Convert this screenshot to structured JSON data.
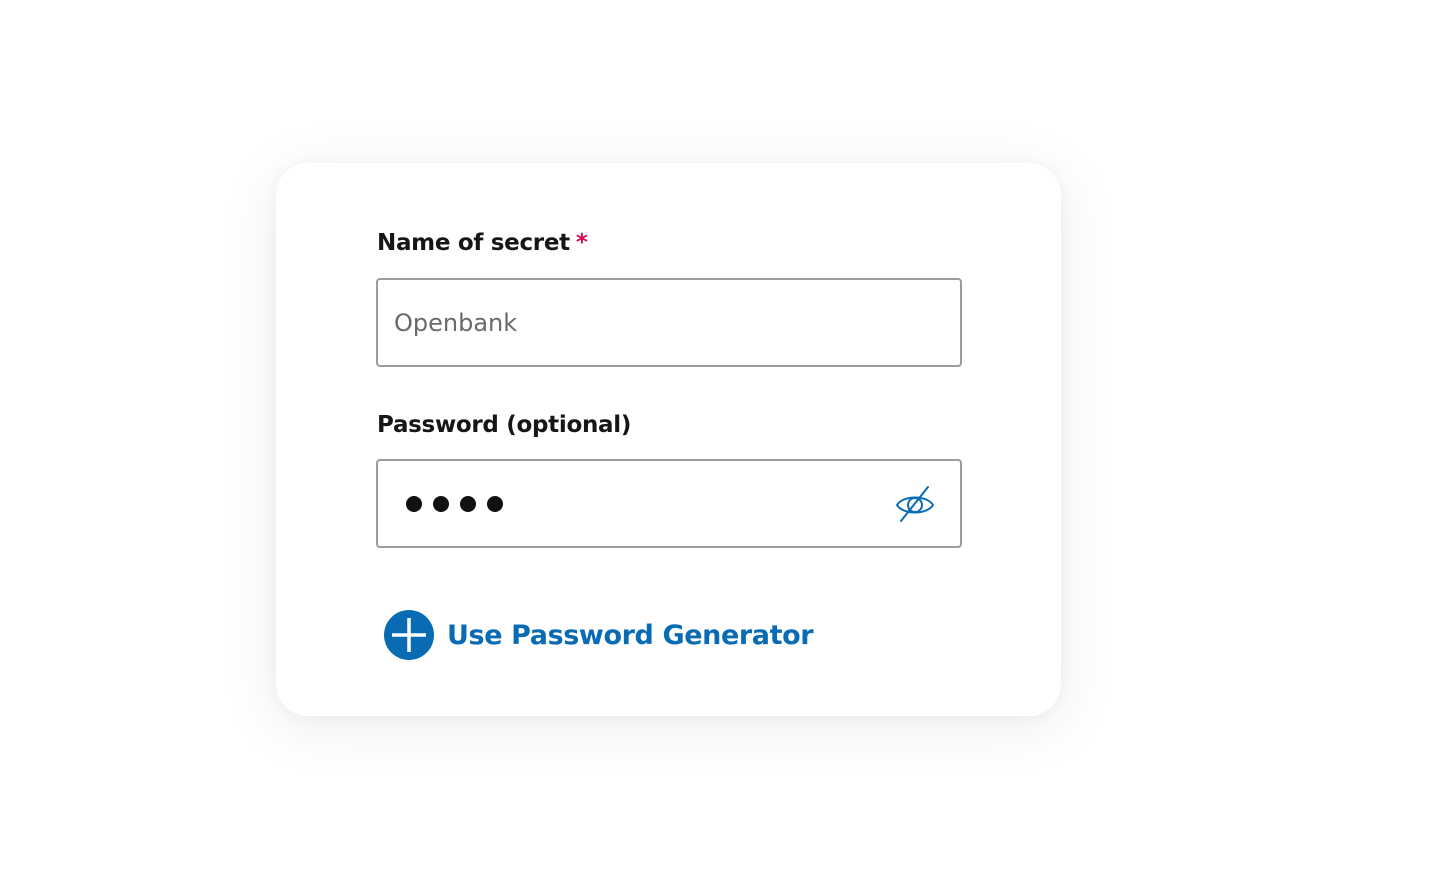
{
  "form": {
    "name_field": {
      "label": "Name of secret",
      "required_marker": "*",
      "value": "",
      "placeholder": "Openbank"
    },
    "password_field": {
      "label": "Password (optional)",
      "masked_length": 4,
      "visibility_icon": "eye-slash-icon"
    },
    "generator_link": {
      "label": "Use Password Generator",
      "icon": "plus-circle-icon"
    }
  },
  "colors": {
    "accent": "#0a6bb5",
    "required": "#d20a5a",
    "text": "#161616",
    "border": "#9c9c9c",
    "placeholder": "#6a6a6a"
  }
}
